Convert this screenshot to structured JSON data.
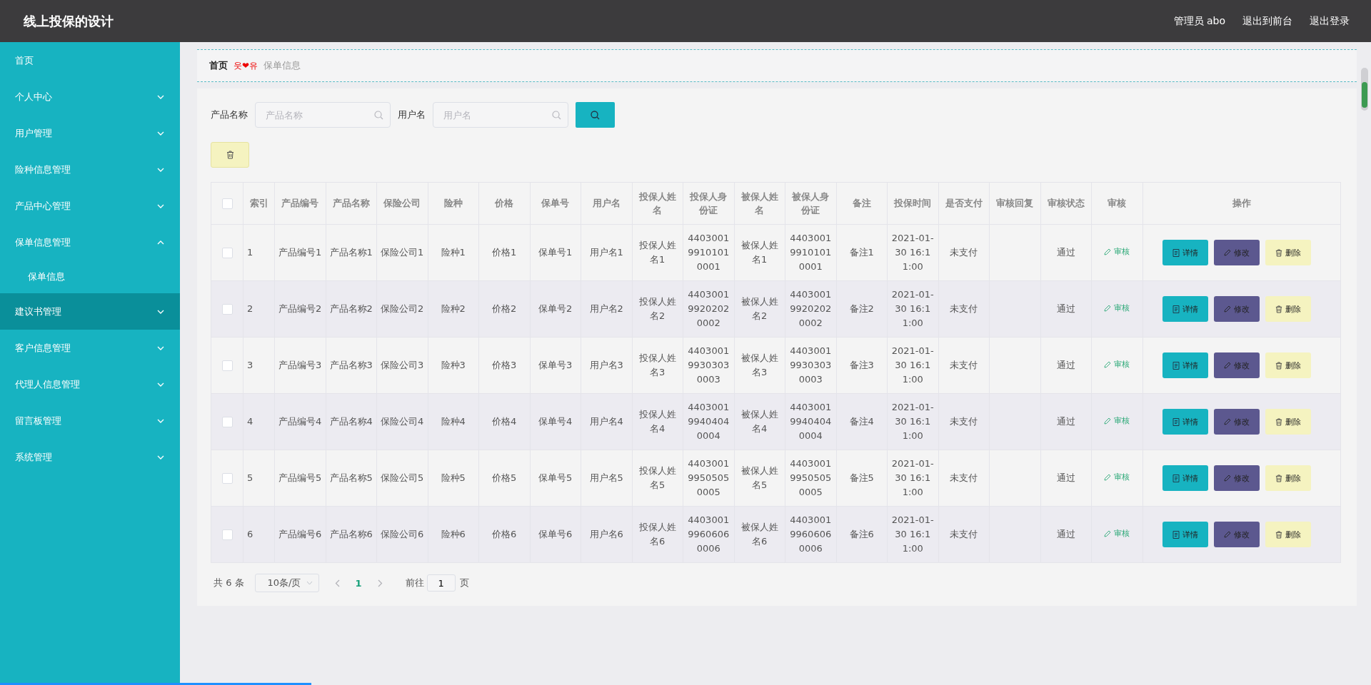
{
  "header": {
    "title": "线上投保的设计",
    "user": "管理员 abo",
    "links": [
      "退出到前台",
      "退出登录"
    ]
  },
  "sidebar": {
    "items": [
      {
        "label": "首页",
        "kind": "link",
        "selected": false
      },
      {
        "label": "个人中心",
        "kind": "submenu",
        "expanded": false,
        "selected": false
      },
      {
        "label": "用户管理",
        "kind": "submenu",
        "expanded": false,
        "selected": false
      },
      {
        "label": "险种信息管理",
        "kind": "submenu",
        "expanded": false,
        "selected": false
      },
      {
        "label": "产品中心管理",
        "kind": "submenu",
        "expanded": false,
        "selected": false
      },
      {
        "label": "保单信息管理",
        "kind": "submenu",
        "expanded": true,
        "selected": false,
        "children": [
          {
            "label": "保单信息",
            "selected": false
          }
        ]
      },
      {
        "label": "建议书管理",
        "kind": "submenu",
        "expanded": false,
        "selected": true
      },
      {
        "label": "客户信息管理",
        "kind": "submenu",
        "expanded": false,
        "selected": false
      },
      {
        "label": "代理人信息管理",
        "kind": "submenu",
        "expanded": false,
        "selected": false
      },
      {
        "label": "留言板管理",
        "kind": "submenu",
        "expanded": false,
        "selected": false
      },
      {
        "label": "系统管理",
        "kind": "submenu",
        "expanded": false,
        "selected": false
      }
    ]
  },
  "breadcrumb": {
    "home": "首页",
    "separator": "웃❤유",
    "current": "保单信息"
  },
  "search": {
    "fields": [
      {
        "label": "产品名称",
        "placeholder": "产品名称"
      },
      {
        "label": "用户名",
        "placeholder": "用户名"
      }
    ]
  },
  "table": {
    "all_checked": false,
    "columns": [
      "索引",
      "产品编号",
      "产品名称",
      "保险公司",
      "险种",
      "价格",
      "保单号",
      "用户名",
      "投保人姓名",
      "投保人身份证",
      "被保人姓名",
      "被保人身份证",
      "备注",
      "投保时间",
      "是否支付",
      "审核回复",
      "审核状态",
      "审核",
      "操作"
    ],
    "rows": [
      {
        "checked": false,
        "index": "1",
        "product_no": "产品编号1",
        "product_name": "产品名称1",
        "company": "保险公司1",
        "type": "险种1",
        "price": "价格1",
        "policy_no": "保单号1",
        "user": "用户名1",
        "applicant": "投保人姓名1",
        "applicant_id": "440300199101010001",
        "insured": "被保人姓名1",
        "insured_id": "440300199101010001",
        "note": "备注1",
        "time": "2021-01-30 16:11:00",
        "paid": "未支付",
        "status": "通过",
        "review": "审核",
        "actions": [
          {
            "kind": "detail",
            "label": "详情"
          },
          {
            "kind": "edit",
            "label": "修改"
          },
          {
            "kind": "delete",
            "label": "删除"
          }
        ]
      },
      {
        "checked": false,
        "index": "2",
        "product_no": "产品编号2",
        "product_name": "产品名称2",
        "company": "保险公司2",
        "type": "险种2",
        "price": "价格2",
        "policy_no": "保单号2",
        "user": "用户名2",
        "applicant": "投保人姓名2",
        "applicant_id": "440300199202020002",
        "insured": "被保人姓名2",
        "insured_id": "440300199202020002",
        "note": "备注2",
        "time": "2021-01-30 16:11:00",
        "paid": "未支付",
        "status": "通过",
        "review": "审核",
        "actions": [
          {
            "kind": "detail",
            "label": "详情"
          },
          {
            "kind": "edit",
            "label": "修改"
          },
          {
            "kind": "delete",
            "label": "删除"
          }
        ]
      },
      {
        "checked": false,
        "index": "3",
        "product_no": "产品编号3",
        "product_name": "产品名称3",
        "company": "保险公司3",
        "type": "险种3",
        "price": "价格3",
        "policy_no": "保单号3",
        "user": "用户名3",
        "applicant": "投保人姓名3",
        "applicant_id": "440300199303030003",
        "insured": "被保人姓名3",
        "insured_id": "440300199303030003",
        "note": "备注3",
        "time": "2021-01-30 16:11:00",
        "paid": "未支付",
        "status": "通过",
        "review": "审核",
        "actions": [
          {
            "kind": "detail",
            "label": "详情"
          },
          {
            "kind": "edit",
            "label": "修改"
          },
          {
            "kind": "delete",
            "label": "删除"
          }
        ]
      },
      {
        "checked": false,
        "index": "4",
        "product_no": "产品编号4",
        "product_name": "产品名称4",
        "company": "保险公司4",
        "type": "险种4",
        "price": "价格4",
        "policy_no": "保单号4",
        "user": "用户名4",
        "applicant": "投保人姓名4",
        "applicant_id": "440300199404040004",
        "insured": "被保人姓名4",
        "insured_id": "440300199404040004",
        "note": "备注4",
        "time": "2021-01-30 16:11:00",
        "paid": "未支付",
        "status": "通过",
        "review": "审核",
        "actions": [
          {
            "kind": "detail",
            "label": "详情"
          },
          {
            "kind": "edit",
            "label": "修改"
          },
          {
            "kind": "delete",
            "label": "删除"
          }
        ]
      },
      {
        "checked": false,
        "index": "5",
        "product_no": "产品编号5",
        "product_name": "产品名称5",
        "company": "保险公司5",
        "type": "险种5",
        "price": "价格5",
        "policy_no": "保单号5",
        "user": "用户名5",
        "applicant": "投保人姓名5",
        "applicant_id": "440300199505050005",
        "insured": "被保人姓名5",
        "insured_id": "440300199505050005",
        "note": "备注5",
        "time": "2021-01-30 16:11:00",
        "paid": "未支付",
        "status": "通过",
        "review": "审核",
        "actions": [
          {
            "kind": "detail",
            "label": "详情"
          },
          {
            "kind": "edit",
            "label": "修改"
          },
          {
            "kind": "delete",
            "label": "删除"
          }
        ]
      },
      {
        "checked": false,
        "index": "6",
        "product_no": "产品编号6",
        "product_name": "产品名称6",
        "company": "保险公司6",
        "type": "险种6",
        "price": "价格6",
        "policy_no": "保单号6",
        "user": "用户名6",
        "applicant": "投保人姓名6",
        "applicant_id": "440300199606060006",
        "insured": "被保人姓名6",
        "insured_id": "440300199606060006",
        "note": "备注6",
        "time": "2021-01-30 16:11:00",
        "paid": "未支付",
        "status": "通过",
        "review": "审核",
        "actions": [
          {
            "kind": "detail",
            "label": "详情"
          },
          {
            "kind": "edit",
            "label": "修改"
          },
          {
            "kind": "delete",
            "label": "删除"
          }
        ]
      }
    ]
  },
  "pagination": {
    "total": "共 6 条",
    "page_size": "10条/页",
    "pages": [
      {
        "label": "1",
        "selected": true
      }
    ],
    "goto": "前往",
    "goto_value": "1",
    "page_unit": "页"
  },
  "video_progress": {
    "level": 0.227
  }
}
